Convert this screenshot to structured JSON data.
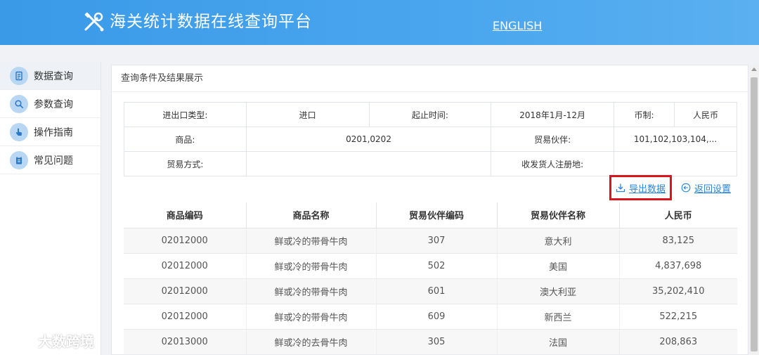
{
  "header": {
    "title": "海关统计数据在线查询平台",
    "lang_link": "ENGLISH",
    "logo_icon": "tools-icon"
  },
  "sidebar": {
    "items": [
      {
        "label": "数据查询",
        "icon": "document-icon",
        "active": true
      },
      {
        "label": "参数查询",
        "icon": "search-icon"
      },
      {
        "label": "操作指南",
        "icon": "hand-pointer-icon"
      },
      {
        "label": "常见问题",
        "icon": "clipboard-icon"
      }
    ]
  },
  "panel": {
    "title": "查询条件及结果展示",
    "conditions": {
      "trade_type_label": "进出口类型:",
      "trade_type_value": "进口",
      "period_label": "起止时间:",
      "period_value": "2018年1月-12月",
      "currency_label": "币制:",
      "currency_value": "人民币",
      "goods_label": "商品:",
      "goods_value": "0201,0202",
      "partner_label": "贸易伙伴:",
      "partner_value": "101,102,103,104,...",
      "method_label": "贸易方式:",
      "method_value": "",
      "registration_label": "收发货人注册地:",
      "registration_value": ""
    },
    "actions": {
      "export_label": "导出数据",
      "back_label": "返回设置"
    },
    "table": {
      "headers": [
        "商品编码",
        "商品名称",
        "贸易伙伴编码",
        "贸易伙伴名称",
        "人民币"
      ],
      "rows": [
        [
          "02012000",
          "鲜或冷的带骨牛肉",
          "307",
          "意大利",
          "83,125"
        ],
        [
          "02012000",
          "鲜或冷的带骨牛肉",
          "502",
          "美国",
          "4,837,698"
        ],
        [
          "02012000",
          "鲜或冷的带骨牛肉",
          "601",
          "澳大利亚",
          "35,202,410"
        ],
        [
          "02012000",
          "鲜或冷的带骨牛肉",
          "609",
          "新西兰",
          "522,215"
        ],
        [
          "02013000",
          "鲜或冷的去骨牛肉",
          "305",
          "法国",
          "208,863"
        ]
      ]
    }
  },
  "watermark": {
    "text": "大数跨境"
  },
  "colors": {
    "header_blue": "#3a9ae8",
    "link_blue": "#2b85d8",
    "highlight_red": "#d9141b"
  }
}
